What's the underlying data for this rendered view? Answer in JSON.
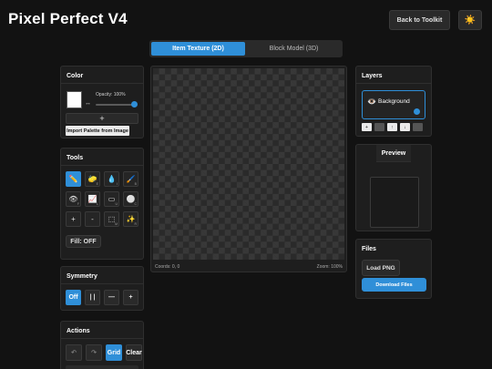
{
  "app": {
    "title": "Pixel Perfect V4"
  },
  "header": {
    "back_label": "Back to Toolkit",
    "theme_icon": "☀️"
  },
  "mode_tabs": [
    {
      "label": "Item Texture (2D)",
      "active": true
    },
    {
      "label": "Block Model (3D)",
      "active": false
    }
  ],
  "color_panel": {
    "title": "Color",
    "current_color": "#ffffff",
    "opacity_label": "Opacity: 100%",
    "opacity_value": 1.0,
    "add_label": "+",
    "import_label": "Import Palette from Image"
  },
  "tools_panel": {
    "title": "Tools",
    "tools": [
      {
        "icon": "✏️",
        "key": "",
        "name": "pencil",
        "active": true
      },
      {
        "icon": "🧽",
        "key": "E",
        "name": "eraser",
        "active": false
      },
      {
        "icon": "💧",
        "key": "I",
        "name": "eyedropper",
        "active": false
      },
      {
        "icon": "🖌️",
        "key": "B",
        "name": "brush",
        "active": false
      },
      {
        "icon": "👁",
        "key": "F",
        "name": "fill-view",
        "active": false
      },
      {
        "icon": "📈",
        "key": "L",
        "name": "line",
        "active": false
      },
      {
        "icon": "▭",
        "key": "U",
        "name": "rectangle",
        "active": false
      },
      {
        "icon": "⚪",
        "key": "C",
        "name": "circle",
        "active": false
      },
      {
        "icon": "+",
        "key": "",
        "name": "zoom-in",
        "active": false
      },
      {
        "icon": "-",
        "key": "",
        "name": "zoom-out",
        "active": false
      },
      {
        "icon": "⬚",
        "key": "M",
        "name": "select",
        "active": false
      },
      {
        "icon": "✨",
        "key": "R",
        "name": "magic",
        "active": false
      }
    ],
    "fill_label": "Fill: OFF"
  },
  "symmetry_panel": {
    "title": "Symmetry",
    "options": [
      {
        "label": "Off",
        "active": true
      },
      {
        "label": "| |",
        "active": false
      },
      {
        "label": "—",
        "active": false
      },
      {
        "label": "+",
        "active": false
      }
    ]
  },
  "actions_panel": {
    "title": "Actions",
    "buttons": [
      {
        "label": "↶",
        "name": "undo",
        "active": false,
        "text": false
      },
      {
        "label": "↷",
        "name": "redo",
        "active": false,
        "text": false
      },
      {
        "label": "Grid",
        "name": "grid",
        "active": true,
        "text": true
      },
      {
        "label": "Clear",
        "name": "clear",
        "active": false,
        "text": true
      }
    ]
  },
  "canvas": {
    "coords_label": "Coords: 0, 0",
    "zoom_label": "Zoom: 100%"
  },
  "layers_panel": {
    "title": "Layers",
    "layers": [
      {
        "name": "Background",
        "visible_icon": "👁️"
      }
    ],
    "actions": [
      {
        "label": "+",
        "dim": false
      },
      {
        "label": "",
        "dim": true
      },
      {
        "label": "↑",
        "dim": false
      },
      {
        "label": "↓",
        "dim": false
      },
      {
        "label": "",
        "dim": true
      }
    ]
  },
  "preview_panel": {
    "title": "Preview"
  },
  "files_panel": {
    "title": "Files",
    "load_label": "Load PNG",
    "download_label": "Download Files"
  },
  "colors": {
    "accent": "#2f8fd8",
    "background": "#121212",
    "panel": "#1e1e1e"
  }
}
